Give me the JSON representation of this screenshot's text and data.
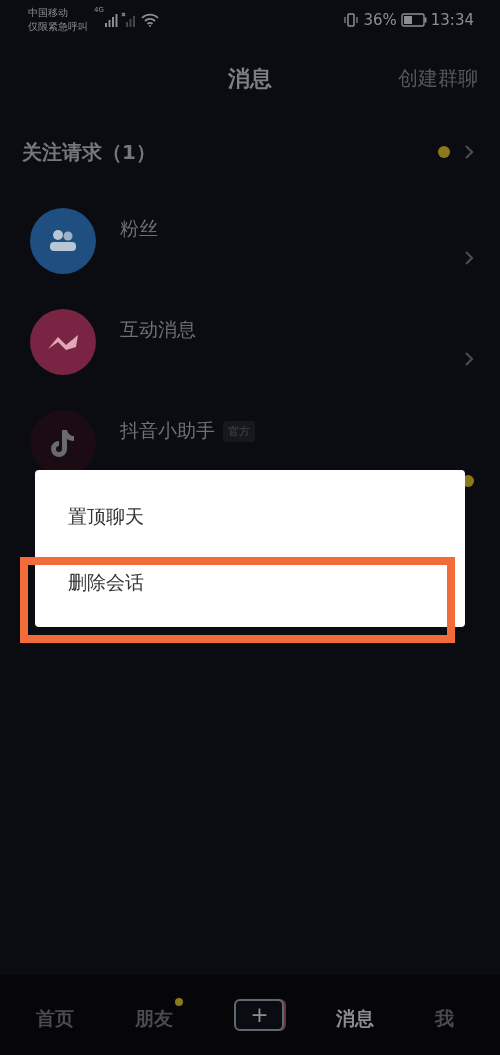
{
  "status_bar": {
    "carrier": "中国移动",
    "carrier_note": "仅限紧急呼叫",
    "network": "4G",
    "battery_percent": "36%",
    "time": "13:34"
  },
  "header": {
    "title": "消息",
    "action": "创建群聊"
  },
  "follow_requests": {
    "label": "关注请求（1）",
    "unread": true
  },
  "conversations": [
    {
      "kind": "fans",
      "name": "粉丝",
      "unread": false
    },
    {
      "kind": "interactions",
      "name": "互动消息",
      "unread": false
    },
    {
      "kind": "assistant",
      "name": "抖音小助手",
      "badge": "官方",
      "unread": true
    }
  ],
  "context_menu": {
    "items": [
      {
        "label": "置顶聊天",
        "highlighted": false
      },
      {
        "label": "删除会话",
        "highlighted": true
      }
    ]
  },
  "bottom_nav": [
    {
      "kind": "tab",
      "label": "首页",
      "selected": false,
      "dot": false
    },
    {
      "kind": "tab",
      "label": "朋友",
      "selected": false,
      "dot": true
    },
    {
      "kind": "create",
      "label": "+"
    },
    {
      "kind": "tab",
      "label": "消息",
      "selected": true,
      "dot": false
    },
    {
      "kind": "tab",
      "label": "我",
      "selected": false,
      "dot": false
    }
  ]
}
